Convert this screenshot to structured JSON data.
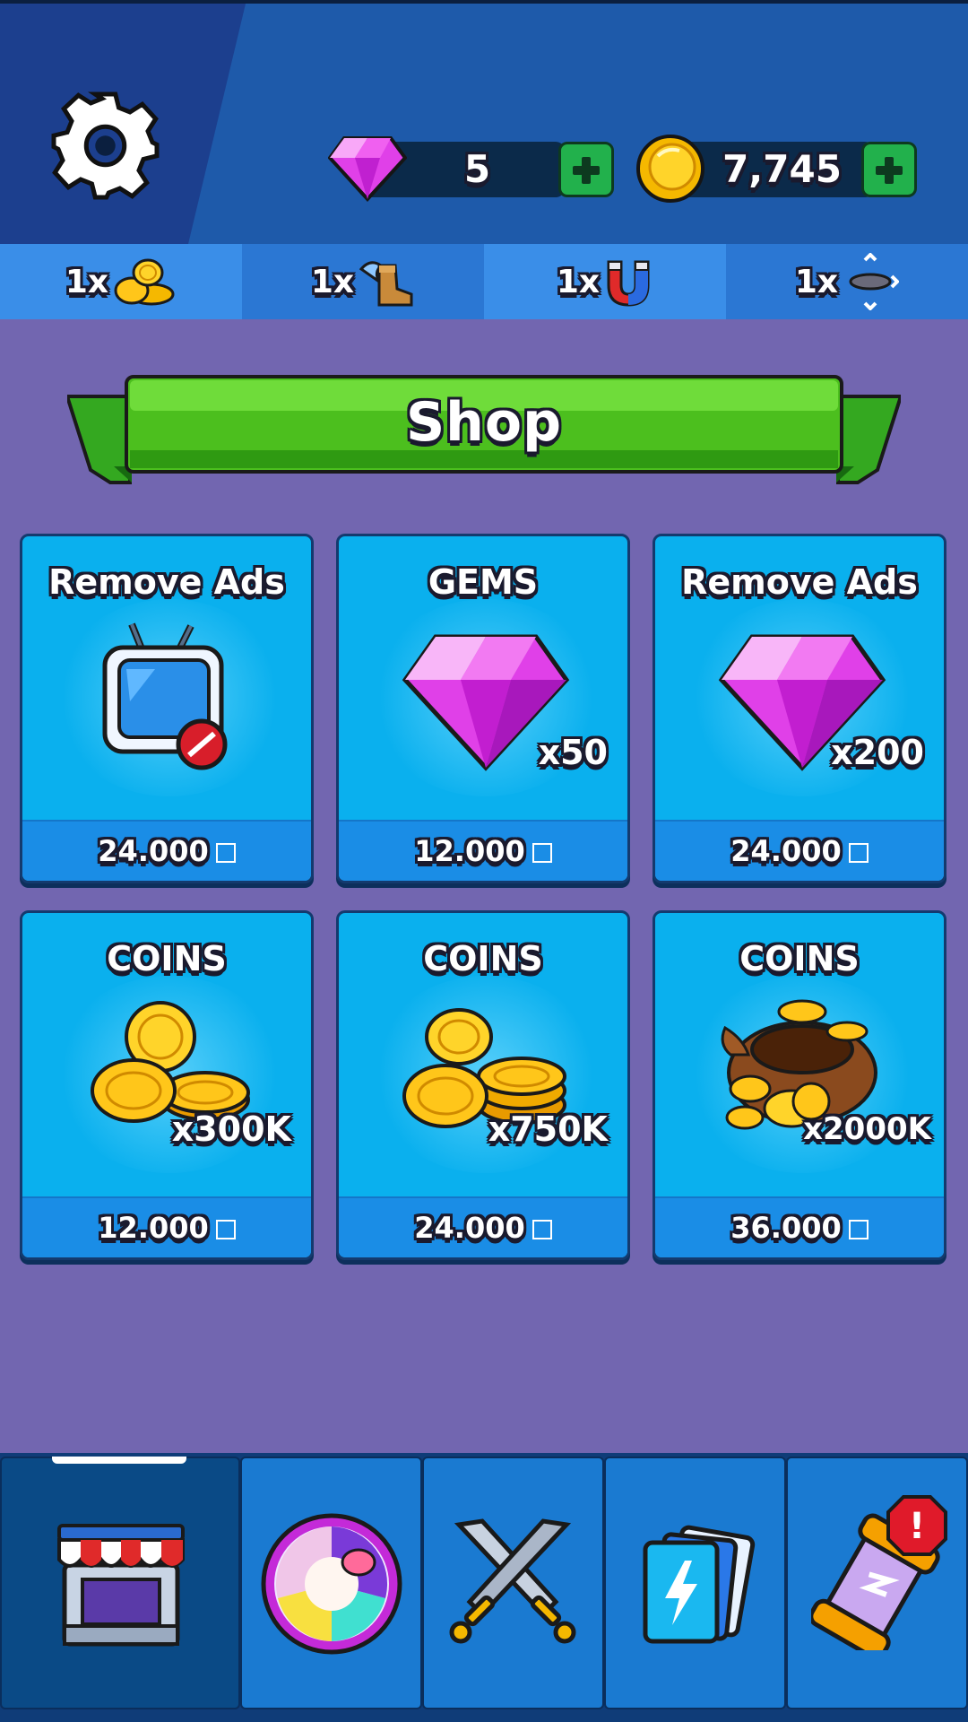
{
  "header": {
    "settings_icon": "gear-icon",
    "gems": {
      "icon": "gem-icon",
      "value": "5"
    },
    "coins": {
      "icon": "coin-icon",
      "value": "7,745"
    }
  },
  "boosters": [
    {
      "label": "1x",
      "icon": "coin-pile-icon"
    },
    {
      "label": "1x",
      "icon": "winged-boot-icon"
    },
    {
      "label": "1x",
      "icon": "magnet-icon"
    },
    {
      "label": "1x",
      "icon": "scale-arrows-icon"
    }
  ],
  "shop": {
    "title": "Shop",
    "items": [
      {
        "title": "Remove Ads",
        "amount": "",
        "price": "24.000",
        "icon": "no-ads-tv-icon"
      },
      {
        "title": "GEMS",
        "amount": "x50",
        "price": "12.000",
        "icon": "gem-icon"
      },
      {
        "title": "Remove Ads",
        "amount": "x200",
        "price": "24.000",
        "icon": "gem-icon"
      },
      {
        "title": "COINS",
        "amount": "x300K",
        "price": "12.000",
        "icon": "coin-stack-icon"
      },
      {
        "title": "COINS",
        "amount": "x750K",
        "price": "24.000",
        "icon": "coin-stack-icon"
      },
      {
        "title": "COINS",
        "amount": "x2000K",
        "price": "36.000",
        "icon": "treasure-sack-icon"
      }
    ]
  },
  "nav": {
    "tabs": [
      {
        "name": "shop",
        "icon": "shop-stall-icon",
        "active": true
      },
      {
        "name": "ball",
        "icon": "ball-icon",
        "active": false
      },
      {
        "name": "battle",
        "icon": "crossed-swords-icon",
        "active": false
      },
      {
        "name": "cards",
        "icon": "cards-icon",
        "active": false
      },
      {
        "name": "rewards",
        "icon": "capsule-icon",
        "active": false,
        "alert": "!"
      }
    ]
  },
  "colors": {
    "background": "#7266b0",
    "header": "#1e5aaa",
    "card": "#0ab0ee",
    "banner": "#4cbf1e",
    "gem": "#e040e8",
    "coin": "#f5b800"
  }
}
